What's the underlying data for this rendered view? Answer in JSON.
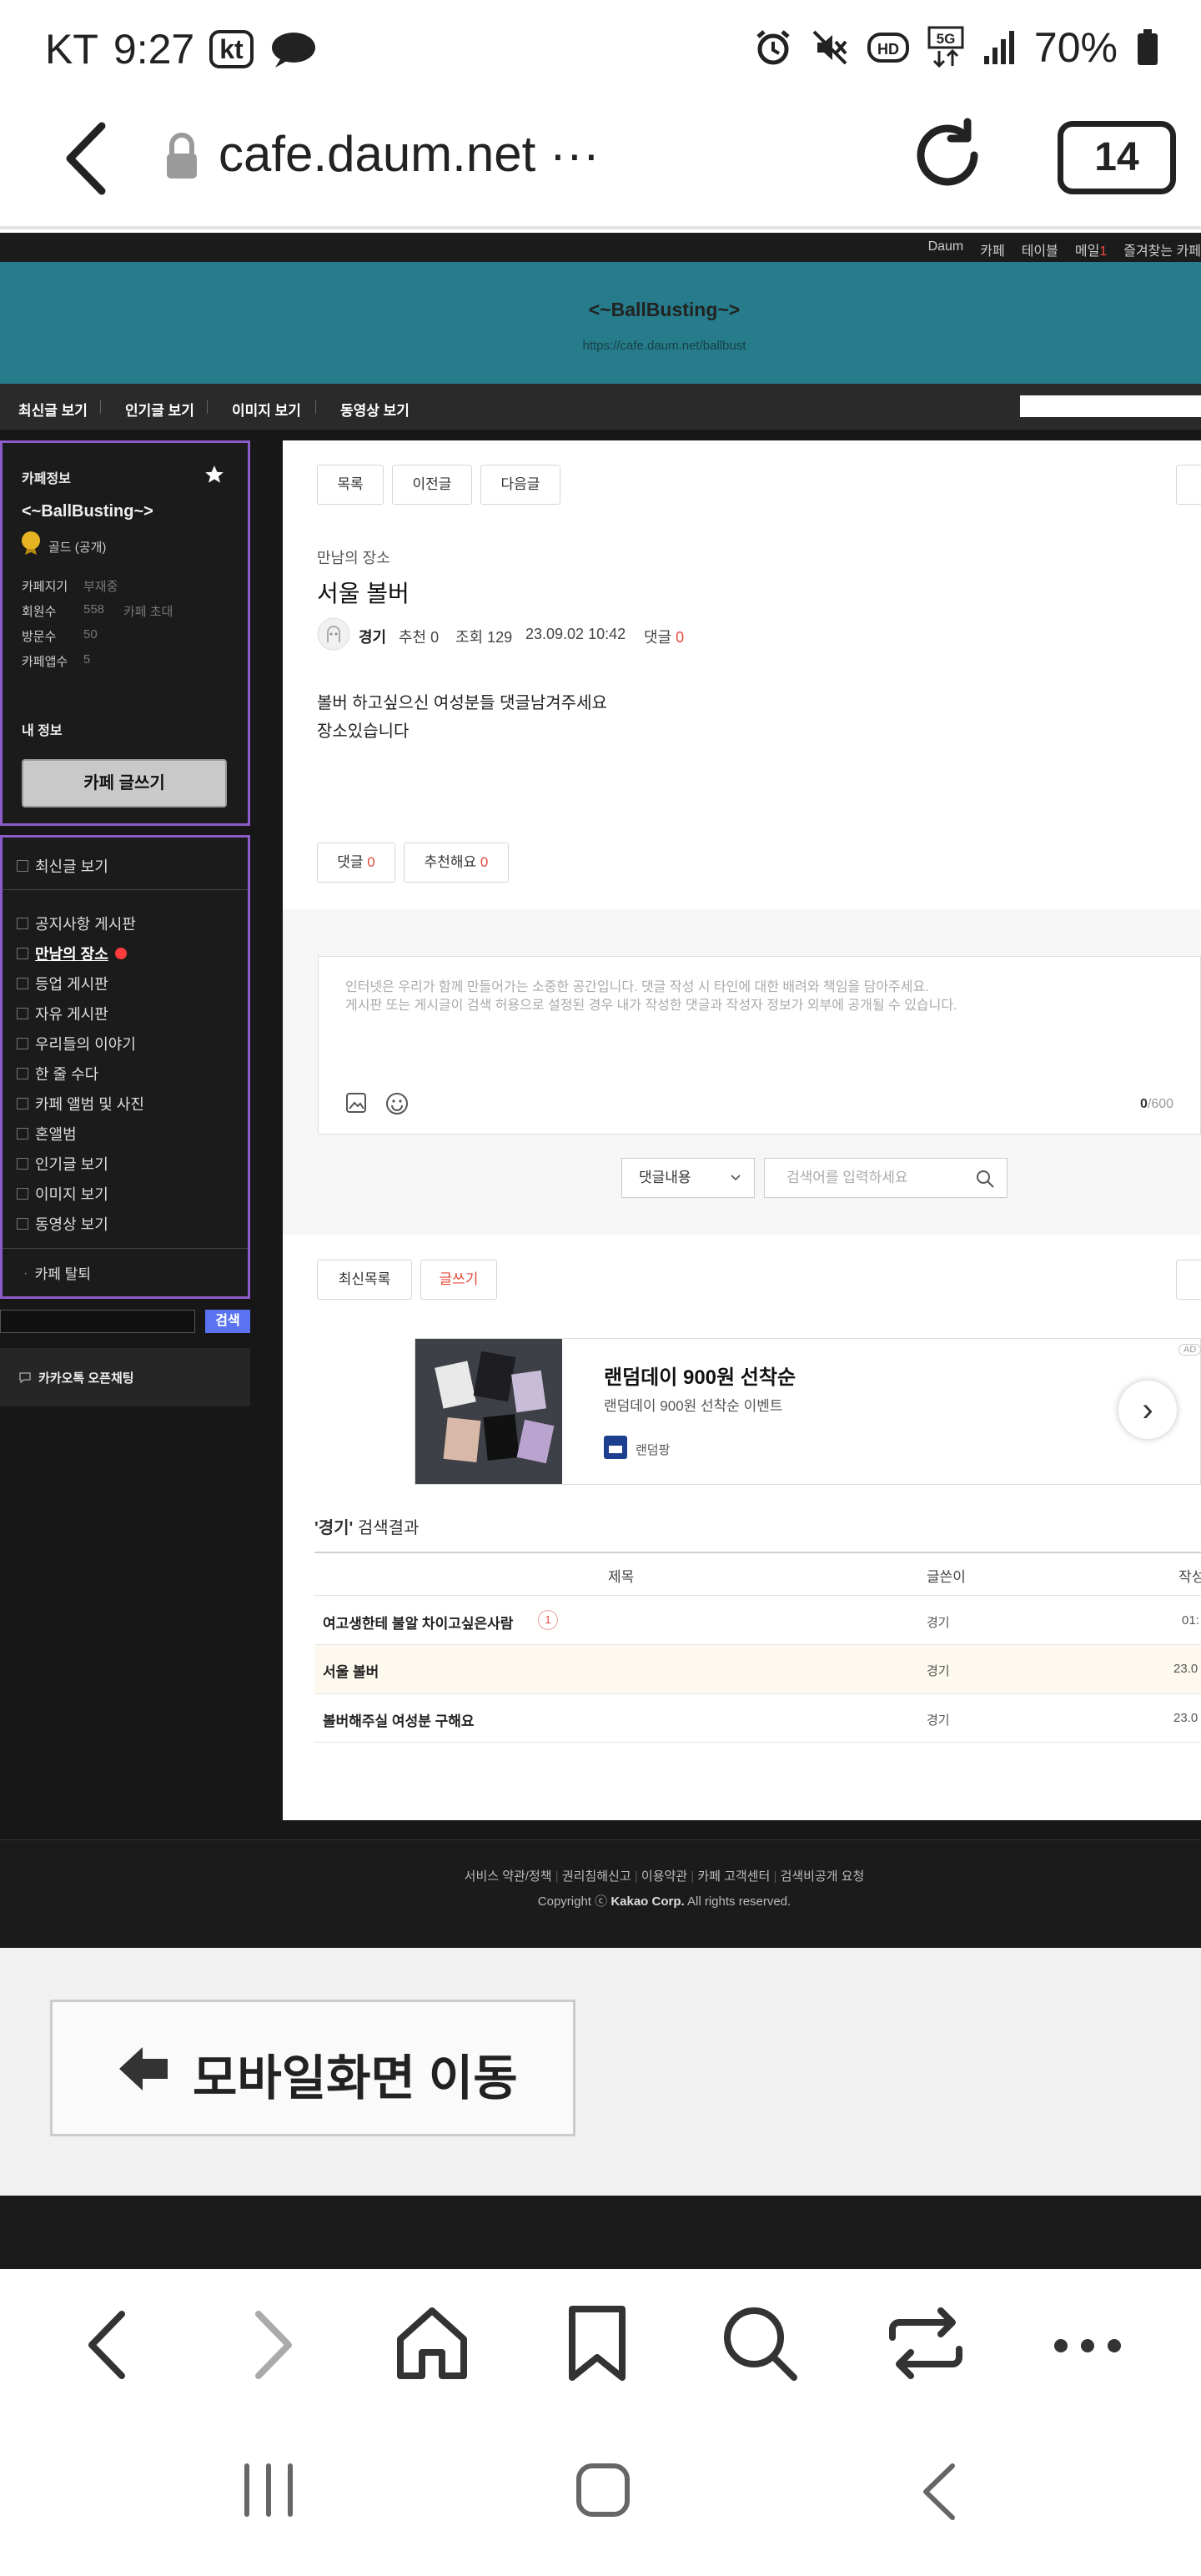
{
  "status_bar": {
    "carrier": "KT",
    "time": "9:27",
    "carrier_badge": "kt",
    "battery": "70%"
  },
  "browser": {
    "url": "cafe.daum.net",
    "more": "···",
    "tab_count": "14"
  },
  "daum_top_links": [
    "Daum",
    "카페",
    "테이블",
    "메일",
    "1",
    "즐겨찾는 카페"
  ],
  "cafe": {
    "title": "<~BallBusting~>",
    "url": "https://cafe.daum.net/ballbust"
  },
  "menubar": {
    "tabs": [
      "최신글 보기",
      "인기글 보기",
      "이미지 보기",
      "동영상 보기"
    ]
  },
  "sidebar": {
    "cafe_info_label": "카페정보",
    "cafe_name": "<~BallBusting~>",
    "grade": "골드 (공개)",
    "stats": [
      {
        "label": "카페지기",
        "value": "부재중"
      },
      {
        "label": "회원수",
        "value": "558",
        "extra": "카페 초대"
      },
      {
        "label": "방문수",
        "value": "50"
      },
      {
        "label": "카페앱수",
        "value": "5"
      }
    ],
    "my_info": "내 정보",
    "write_button": "카페 글쓰기",
    "latest": "최신글 보기",
    "boards": [
      "공지사항 게시판",
      "만남의 장소",
      "등업 게시판",
      "자유 게시판",
      "우리들의 이야기",
      "한 줄 수다",
      "카페 앨범 및 사진",
      "혼앨범",
      "인기글 보기",
      "이미지 보기",
      "동영상 보기"
    ],
    "leave": "카페 탈퇴",
    "search_button": "검색",
    "kakao_chat": "카카오톡 오픈채팅"
  },
  "post": {
    "nav_buttons": [
      "목록",
      "이전글",
      "다음글"
    ],
    "board": "만남의 장소",
    "title": "서울 볼버",
    "author": "경기",
    "recommend": "추천 0",
    "views": "조회 129",
    "date": "23.09.02 10:42",
    "comments_label": "댓글",
    "comments_count": "0",
    "body_line1": "볼버 하고싶으신 여성분들 댓글남겨주세요",
    "body_line2": "장소있습니다",
    "comment_btn": "댓글",
    "comment_btn_count": "0",
    "like_btn": "추천해요",
    "like_btn_count": "0"
  },
  "comment_box": {
    "placeholder_line1": "인터넷은 우리가 함께 만들어가는 소중한 공간입니다. 댓글 작성 시 타인에 대한 배려와 책임을 담아주세요.",
    "placeholder_line2": "게시판 또는 게시글이 검색 허용으로 설정된 경우 내가 작성한 댓글과 작성자 정보가 외부에 공개될 수 있습니다.",
    "counter_current": "0",
    "counter_max": "/600"
  },
  "comment_search": {
    "select": "댓글내용",
    "placeholder": "검색어를 입력하세요"
  },
  "list_buttons": {
    "latest": "최신목록",
    "write": "글쓰기"
  },
  "ad": {
    "title": "랜덤데이 900원 선착순",
    "subtitle": "랜덤데이 900원 선착순 이벤트",
    "brand": "랜덤팡",
    "badge": "AD"
  },
  "search_results": {
    "title_quote": "'경기'",
    "title_rest": " 검색결과",
    "col_title": "제목",
    "col_author": "글쓴이",
    "col_date": "작성",
    "rows": [
      {
        "title": "여고생한테 불알 차이고싶은사람",
        "comments": "1",
        "author": "경기",
        "date": "01:"
      },
      {
        "title": "서울 볼버",
        "author": "경기",
        "date": "23.0"
      },
      {
        "title": "볼버해주실 여성분 구해요",
        "author": "경기",
        "date": "23.0"
      }
    ]
  },
  "footer": {
    "links": [
      "서비스 약관/정책",
      "권리침해신고",
      "이용약관",
      "카페 고객센터",
      "검색비공개 요청"
    ],
    "copyright_prefix": "Copyright ⓒ ",
    "copyright_company": "Kakao Corp.",
    "copyright_suffix": " All rights reserved."
  },
  "mobile_switch": "모바일화면 이동"
}
